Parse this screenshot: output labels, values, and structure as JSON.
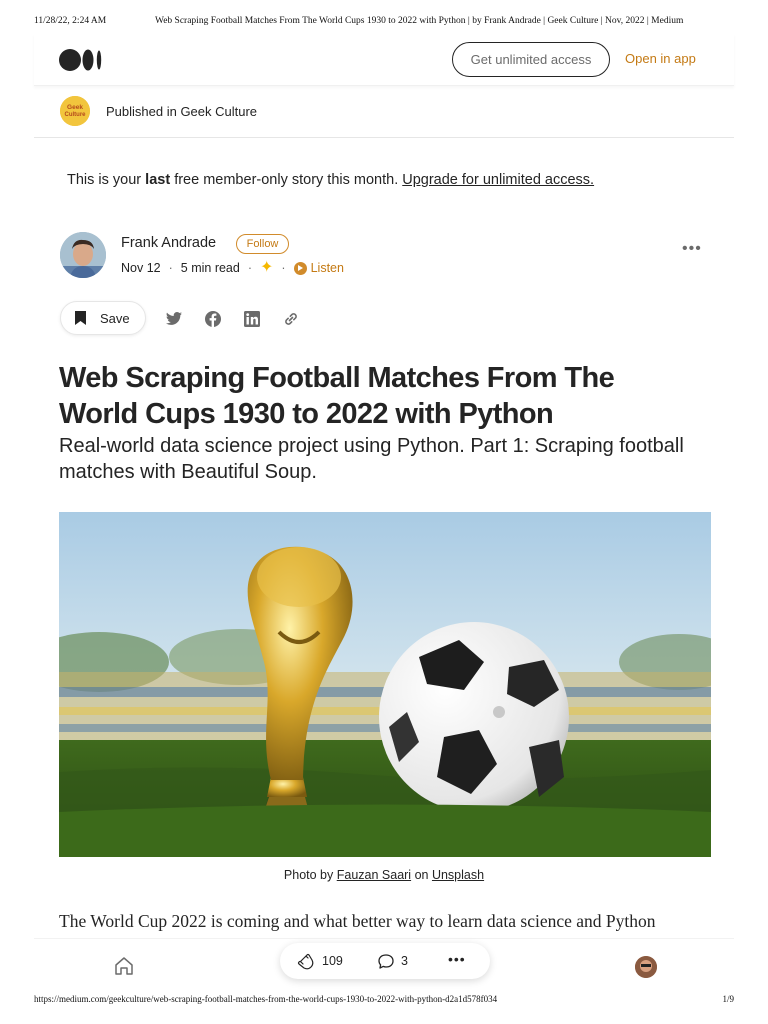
{
  "print_header": {
    "timestamp": "11/28/22, 2:24 AM",
    "title": "Web Scraping Football Matches From The World Cups 1930 to 2022 with Python | by Frank Andrade | Geek Culture | Nov, 2022 | Medium"
  },
  "topbar": {
    "logo": "medium-logo",
    "cta_label": "Get unlimited access",
    "open_app_label": "Open in app"
  },
  "publication": {
    "logo_text": "Geek Culture",
    "label": "Published in Geek Culture"
  },
  "upsell": {
    "prefix": "This is your ",
    "emphasis": "last",
    "middle": " free member-only story this month. ",
    "link": "Upgrade for unlimited access."
  },
  "author": {
    "name": "Frank Andrade",
    "follow_label": "Follow",
    "date": "Nov 12",
    "read_time": "5 min read",
    "listen_label": "Listen",
    "member_icon": "sparkle-icon",
    "more_icon": "more-icon"
  },
  "actions": {
    "save_label": "Save",
    "share_icons": [
      "twitter-icon",
      "facebook-icon",
      "linkedin-icon",
      "link-icon"
    ]
  },
  "article": {
    "title": "Web Scraping Football Matches From The World Cups 1930 to 2022 with Python",
    "subtitle": "Real-world data science project using Python. Part 1: Scraping football matches with Beautiful Soup.",
    "caption_prefix": "Photo by ",
    "caption_author": "Fauzan Saari",
    "caption_mid": " on ",
    "caption_source": "Unsplash",
    "body_first_line": "The World Cup 2022 is coming and what better way to learn data science and Python"
  },
  "bottom_bar": {
    "clap_count": "109",
    "response_count": "3",
    "more_icon": "more-icon"
  },
  "print_footer": {
    "url": "https://medium.com/geekculture/web-scraping-football-matches-from-the-world-cups-1930-to-2022-with-python-d2a1d578f034",
    "page": "1/9"
  },
  "colors": {
    "accent": "#c47a14",
    "text": "#242424",
    "muted": "#6b6b6b"
  }
}
